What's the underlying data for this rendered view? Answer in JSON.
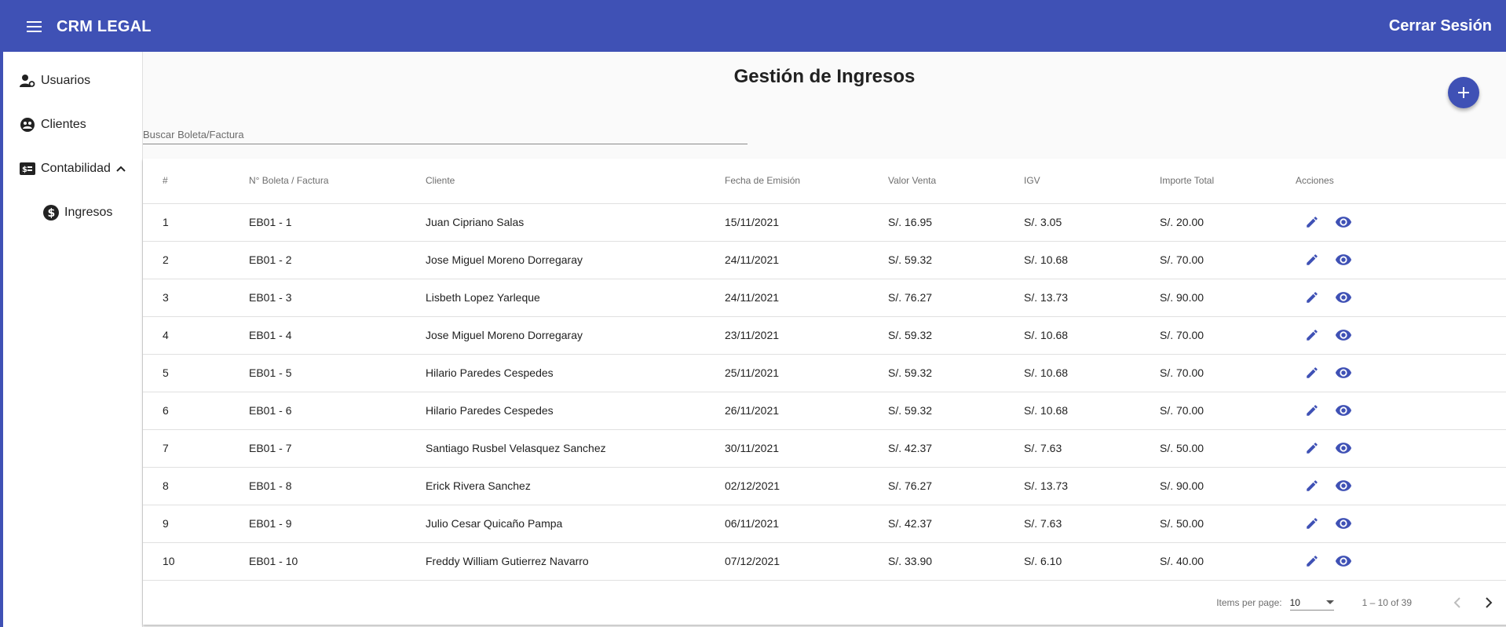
{
  "app": {
    "title": "CRM LEGAL",
    "logout_label": "Cerrar Sesión"
  },
  "sidebar": {
    "items": [
      {
        "label": "Usuarios",
        "icon": "user-settings-icon"
      },
      {
        "label": "Clientes",
        "icon": "clients-icon"
      },
      {
        "label": "Contabilidad",
        "icon": "accounting-icon",
        "expanded": true
      },
      {
        "label": "Ingresos",
        "icon": "dollar-circle-icon"
      }
    ]
  },
  "page": {
    "title": "Gestión de Ingresos",
    "search_placeholder": "Buscar Boleta/Factura"
  },
  "table": {
    "columns": [
      "#",
      "N° Boleta / Factura",
      "Cliente",
      "Fecha de Emisión",
      "Valor Venta",
      "IGV",
      "Importe Total",
      "Acciones"
    ],
    "rows": [
      [
        "1",
        "EB01 - 1",
        "Juan Cipriano Salas",
        "15/11/2021",
        "S/. 16.95",
        "S/. 3.05",
        "S/. 20.00"
      ],
      [
        "2",
        "EB01 - 2",
        "Jose Miguel Moreno Dorregaray",
        "24/11/2021",
        "S/. 59.32",
        "S/. 10.68",
        "S/. 70.00"
      ],
      [
        "3",
        "EB01 - 3",
        "Lisbeth Lopez Yarleque",
        "24/11/2021",
        "S/. 76.27",
        "S/. 13.73",
        "S/. 90.00"
      ],
      [
        "4",
        "EB01 - 4",
        "Jose Miguel Moreno Dorregaray",
        "23/11/2021",
        "S/. 59.32",
        "S/. 10.68",
        "S/. 70.00"
      ],
      [
        "5",
        "EB01 - 5",
        "Hilario Paredes Cespedes",
        "25/11/2021",
        "S/. 59.32",
        "S/. 10.68",
        "S/. 70.00"
      ],
      [
        "6",
        "EB01 - 6",
        "Hilario Paredes Cespedes",
        "26/11/2021",
        "S/. 59.32",
        "S/. 10.68",
        "S/. 70.00"
      ],
      [
        "7",
        "EB01 - 7",
        "Santiago Rusbel Velasquez Sanchez",
        "30/11/2021",
        "S/. 42.37",
        "S/. 7.63",
        "S/. 50.00"
      ],
      [
        "8",
        "EB01 - 8",
        "Erick Rivera Sanchez",
        "02/12/2021",
        "S/. 76.27",
        "S/. 13.73",
        "S/. 90.00"
      ],
      [
        "9",
        "EB01 - 9",
        "Julio Cesar Quicaño Pampa",
        "06/11/2021",
        "S/. 42.37",
        "S/. 7.63",
        "S/. 50.00"
      ],
      [
        "10",
        "EB01 - 10",
        "Freddy William Gutierrez Navarro",
        "07/12/2021",
        "S/. 33.90",
        "S/. 6.10",
        "S/. 40.00"
      ]
    ]
  },
  "paginator": {
    "items_label": "Items per page:",
    "page_size": "10",
    "range": "1 – 10 of 39"
  },
  "colors": {
    "primary": "#3f51b5",
    "background": "#fafafa"
  }
}
